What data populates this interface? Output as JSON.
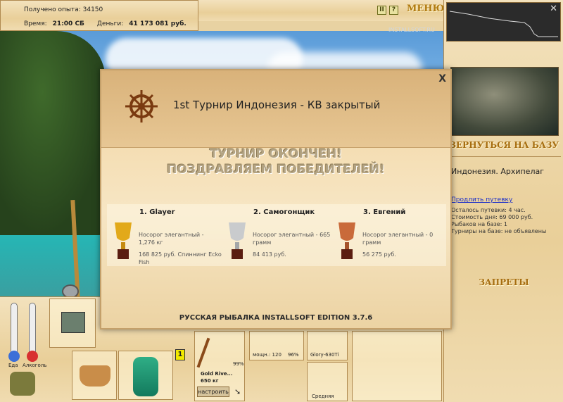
{
  "status": {
    "exp_label": "Получено опыта:",
    "exp_value": "34150",
    "time_label": "Время:",
    "time_value": "21:00 СБ",
    "money_label": "Деньги:",
    "money_value": "41 173 081 руб."
  },
  "menu": {
    "pause": "II",
    "help": "?",
    "menu_label": "МЕНЮ"
  },
  "right": {
    "back_button": "ВЕРНУТЬСЯ НА БАЗУ",
    "location": "Индонезия. Архипелаг",
    "extend_link": "Продлить путевку",
    "trip_left": "Осталось путевки: 4 час.",
    "day_cost": "Стоимость дня: 69 000 руб.",
    "fishers": "Рыбаков на базе: 1",
    "tournaments": "Турниры на базе: не объявлены",
    "bans_button": "ЗАПРЕТЫ"
  },
  "modal": {
    "close": "X",
    "title": "1st Турнир Индонезия - КВ закрытый",
    "finished_line1": "ТУРНИР ОКОНЧЕН!",
    "finished_line2": "ПОЗДРАВЛЯЕМ ПОБЕДИТЕЛЕЙ!",
    "winners": [
      {
        "name": "1. Glayer",
        "fish": "Носорог элегантный - 1,276 кг",
        "prize": "168 825 руб. Спиннинг Ecko Fish",
        "cup": "gold"
      },
      {
        "name": "2. Самогонщик",
        "fish": "Носорог элегантный - 665 грамм",
        "prize": "84 413 руб.",
        "cup": "silver"
      },
      {
        "name": "3. Евгений",
        "fish": "Носорог элегантный - 0 грамм",
        "prize": "56 275 руб.",
        "cup": "bronze"
      }
    ],
    "version": "РУССКАЯ РЫБАЛКА INSTALLSOFT EDITION 3.7.6"
  },
  "inventory": {
    "food_label": "Еда",
    "alcohol_label": "Алкоголь",
    "slot_badge": "1",
    "rod_name": "Gold Rive...",
    "rod_weight": "650 кг",
    "rod_percent": "99%",
    "reel_power": "мощн.: 120",
    "reel_percent": "96%",
    "line_name": "Glory-630Ti",
    "lure_name": "Средняя",
    "adjust_button": "настроить"
  },
  "watermark": "INSTALLSOFT.RU",
  "colors": {
    "accent": "#a66d10",
    "link": "#1c2fc9"
  }
}
